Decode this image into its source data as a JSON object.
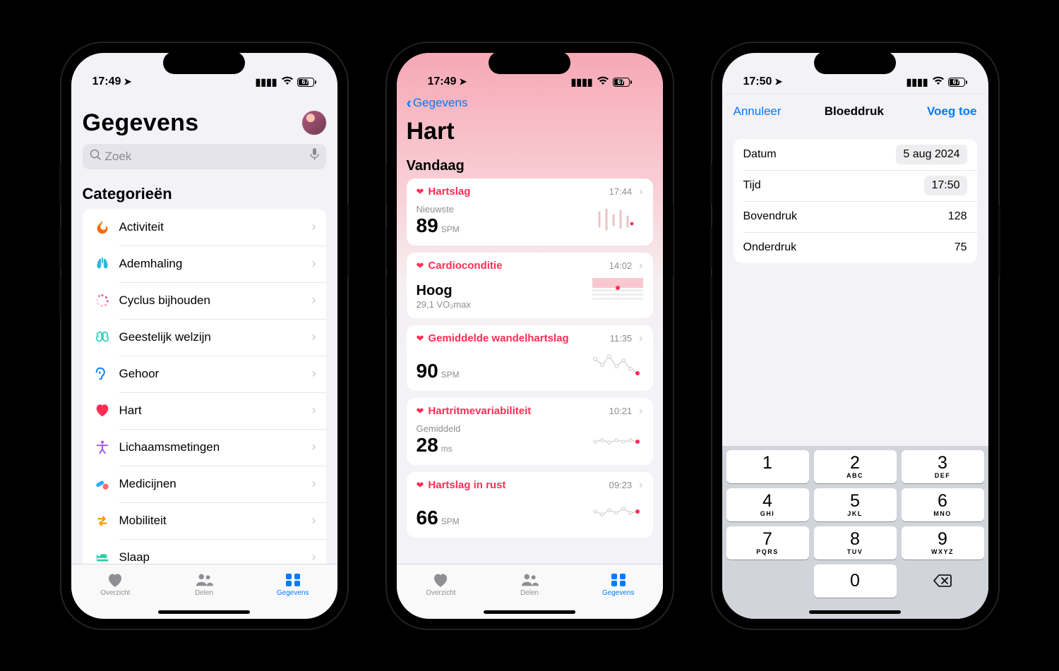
{
  "status": {
    "time1": "17:49",
    "time2": "17:49",
    "time3": "17:50",
    "battery": "67"
  },
  "tabs": {
    "overview": "Overzicht",
    "share": "Delen",
    "data": "Gegevens"
  },
  "screen1": {
    "title": "Gegevens",
    "search_placeholder": "Zoek",
    "section": "Categorieën",
    "categories": [
      {
        "label": "Activiteit",
        "icon": "flame",
        "color": "#ff6a00"
      },
      {
        "label": "Ademhaling",
        "icon": "lungs",
        "color": "#2fb7e0"
      },
      {
        "label": "Cyclus bijhouden",
        "icon": "cycle",
        "color": "#e85b9b"
      },
      {
        "label": "Geestelijk welzijn",
        "icon": "brain",
        "color": "#34d0c0"
      },
      {
        "label": "Gehoor",
        "icon": "ear",
        "color": "#0a84ff"
      },
      {
        "label": "Hart",
        "icon": "heart",
        "color": "#ff2d55"
      },
      {
        "label": "Lichaamsmetingen",
        "icon": "body",
        "color": "#a259ff"
      },
      {
        "label": "Medicijnen",
        "icon": "pills",
        "color": "#30b0ff"
      },
      {
        "label": "Mobiliteit",
        "icon": "mobility",
        "color": "#ff9500"
      },
      {
        "label": "Slaap",
        "icon": "bed",
        "color": "#2fcba8"
      }
    ]
  },
  "screen2": {
    "back": "Gegevens",
    "title": "Hart",
    "today": "Vandaag",
    "cards": [
      {
        "title": "Hartslag",
        "time": "17:44",
        "sub": "Nieuwste",
        "value": "89",
        "unit": "SPM"
      },
      {
        "title": "Cardioconditie",
        "time": "14:02",
        "sub": "",
        "value": "Hoog",
        "unit": "",
        "detail": "29,1 VO₂max"
      },
      {
        "title": "Gemiddelde wandelhartslag",
        "time": "11:35",
        "sub": "",
        "value": "90",
        "unit": "SPM"
      },
      {
        "title": "Hartritmevariabiliteit",
        "time": "10:21",
        "sub": "Gemiddeld",
        "value": "28",
        "unit": "ms"
      },
      {
        "title": "Hartslag in rust",
        "time": "09:23",
        "sub": "",
        "value": "66",
        "unit": "SPM"
      }
    ]
  },
  "screen3": {
    "cancel": "Annuleer",
    "title": "Bloeddruk",
    "add": "Voeg toe",
    "rows": [
      {
        "label": "Datum",
        "value": "5 aug 2024",
        "pill": true
      },
      {
        "label": "Tijd",
        "value": "17:50",
        "pill": true
      },
      {
        "label": "Bovendruk",
        "value": "128",
        "pill": false
      },
      {
        "label": "Onderdruk",
        "value": "75",
        "pill": false
      }
    ],
    "keys": [
      {
        "n": "1",
        "s": ""
      },
      {
        "n": "2",
        "s": "ABC"
      },
      {
        "n": "3",
        "s": "DEF"
      },
      {
        "n": "4",
        "s": "GHI"
      },
      {
        "n": "5",
        "s": "JKL"
      },
      {
        "n": "6",
        "s": "MNO"
      },
      {
        "n": "7",
        "s": "PQRS"
      },
      {
        "n": "8",
        "s": "TUV"
      },
      {
        "n": "9",
        "s": "WXYZ"
      }
    ],
    "key0": "0"
  }
}
